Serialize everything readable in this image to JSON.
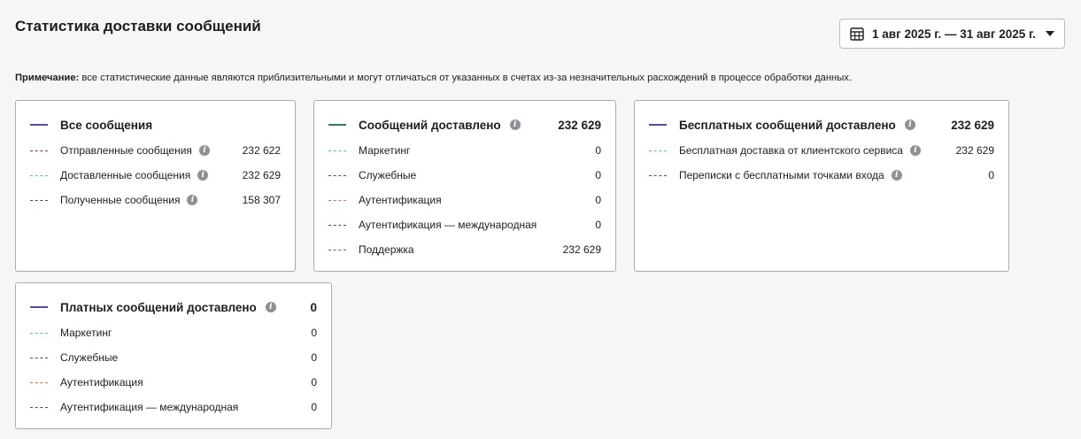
{
  "page": {
    "title": "Статистика доставки сообщений",
    "date_range": "1 авг 2025 г. — 31 авг 2025 г.",
    "note_label": "Примечание:",
    "note_text": " все статистические данные являются приблизительными и могут отличаться от указанных в счетах из-за незначительных расхождений в процессе обработки данных."
  },
  "colors": {
    "purple": "#5b4a9e",
    "teal": "#2f7a6e",
    "cyan": "#4cc3cf",
    "magenta": "#8e2f5c",
    "orange": "#e06a4c",
    "brown": "#7a3b2e"
  },
  "icons": {
    "date_picker": "calendar-icon",
    "dropdown": "caret-down-icon",
    "info": "info-icon"
  },
  "cards": {
    "all": {
      "title": "Все сообщения",
      "rows": [
        {
          "label": "Отправленные сообщения",
          "value": "232 622"
        },
        {
          "label": "Доставленные сообщения",
          "value": "232 629"
        },
        {
          "label": "Полученные сообщения",
          "value": "158 307"
        }
      ]
    },
    "delivered": {
      "title": "Сообщений доставлено",
      "total": "232 629",
      "rows": [
        {
          "label": "Маркетинг",
          "value": "0"
        },
        {
          "label": "Служебные",
          "value": "0"
        },
        {
          "label": "Аутентификация",
          "value": "0"
        },
        {
          "label": "Аутентификация — международная",
          "value": "0"
        },
        {
          "label": "Поддержка",
          "value": "232 629"
        }
      ]
    },
    "free": {
      "title": "Бесплатных сообщений доставлено",
      "total": "232 629",
      "rows": [
        {
          "label": "Бесплатная доставка от клиентского сервиса",
          "value": "232 629"
        },
        {
          "label": "Переписки с бесплатными точками входа",
          "value": "0"
        }
      ]
    },
    "paid": {
      "title": "Платных сообщений доставлено",
      "total": "0",
      "rows": [
        {
          "label": "Маркетинг",
          "value": "0"
        },
        {
          "label": "Служебные",
          "value": "0"
        },
        {
          "label": "Аутентификация",
          "value": "0"
        },
        {
          "label": "Аутентификация — международная",
          "value": "0"
        }
      ]
    }
  }
}
